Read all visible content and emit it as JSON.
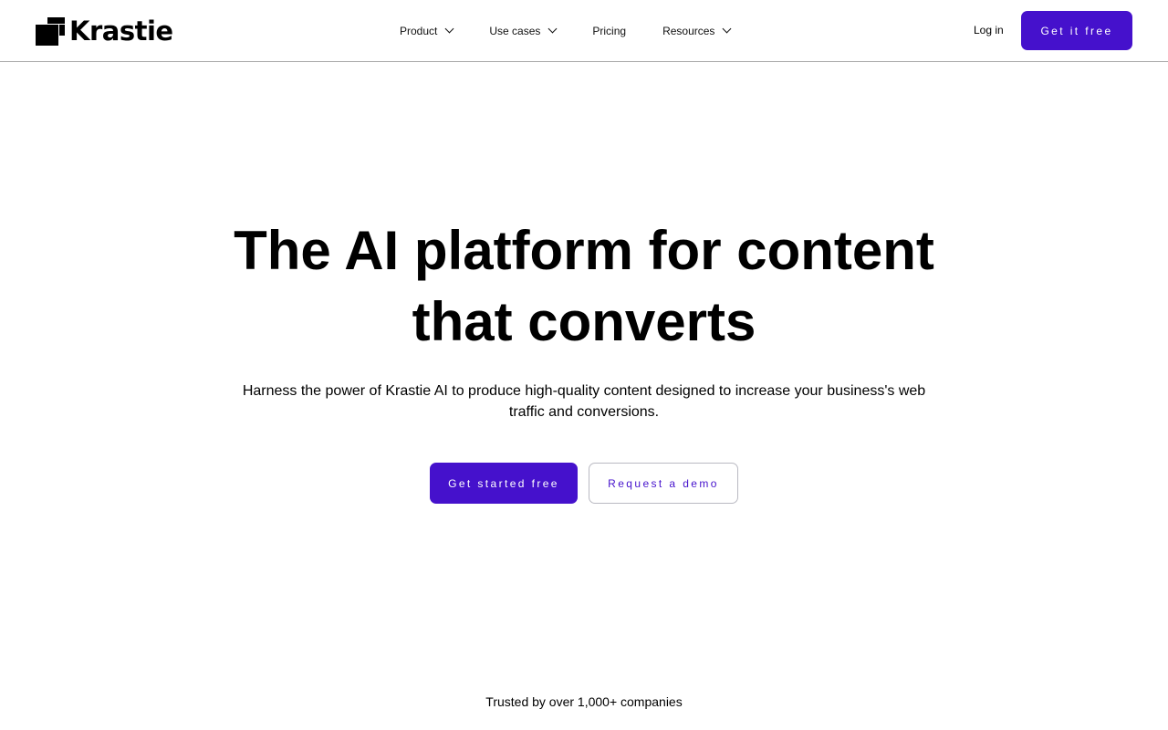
{
  "header": {
    "logo_text": "Krastie",
    "nav": [
      {
        "label": "Product",
        "has_dropdown": true
      },
      {
        "label": "Use cases",
        "has_dropdown": true
      },
      {
        "label": "Pricing",
        "has_dropdown": false
      },
      {
        "label": "Resources",
        "has_dropdown": true
      }
    ],
    "login_label": "Log in",
    "cta_label": "Get it free"
  },
  "hero": {
    "title_line1": "The AI platform for content",
    "title_line2": "that converts",
    "subtitle": "Harness the power of Krastie AI to produce high-quality content designed to increase your business's web traffic and conversions.",
    "primary_cta": "Get started free",
    "secondary_cta": "Request a demo"
  },
  "trusted": {
    "text": "Trusted by over 1,000+ companies"
  },
  "colors": {
    "accent": "#4511cc",
    "divider": "#a8a8a8",
    "outline_border": "#b9b9c2"
  }
}
